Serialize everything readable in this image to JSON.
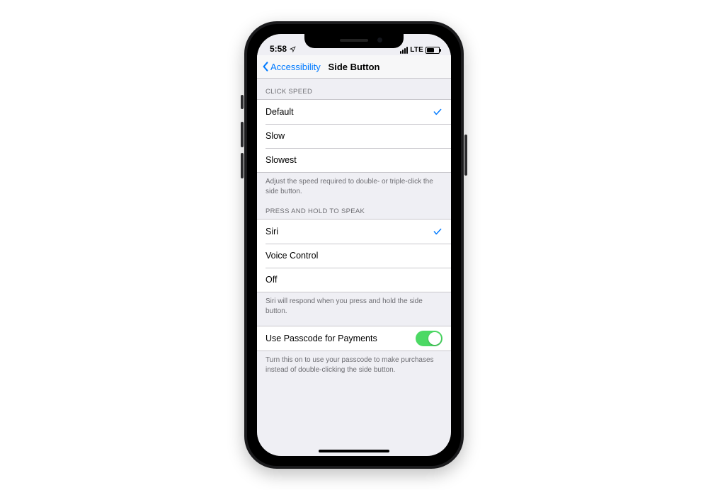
{
  "status": {
    "time": "5:58",
    "network": "LTE"
  },
  "nav": {
    "back_label": "Accessibility",
    "title": "Side Button"
  },
  "click_speed": {
    "header": "CLICK SPEED",
    "options": [
      {
        "label": "Default",
        "selected": true
      },
      {
        "label": "Slow",
        "selected": false
      },
      {
        "label": "Slowest",
        "selected": false
      }
    ],
    "footer": "Adjust the speed required to double- or triple-click the side button."
  },
  "press_hold": {
    "header": "PRESS AND HOLD TO SPEAK",
    "options": [
      {
        "label": "Siri",
        "selected": true
      },
      {
        "label": "Voice Control",
        "selected": false
      },
      {
        "label": "Off",
        "selected": false
      }
    ],
    "footer": "Siri will respond when you press and hold the side button."
  },
  "passcode": {
    "label": "Use Passcode for Payments",
    "on": true,
    "footer": "Turn this on to use your passcode to make purchases instead of double-clicking the side button."
  }
}
